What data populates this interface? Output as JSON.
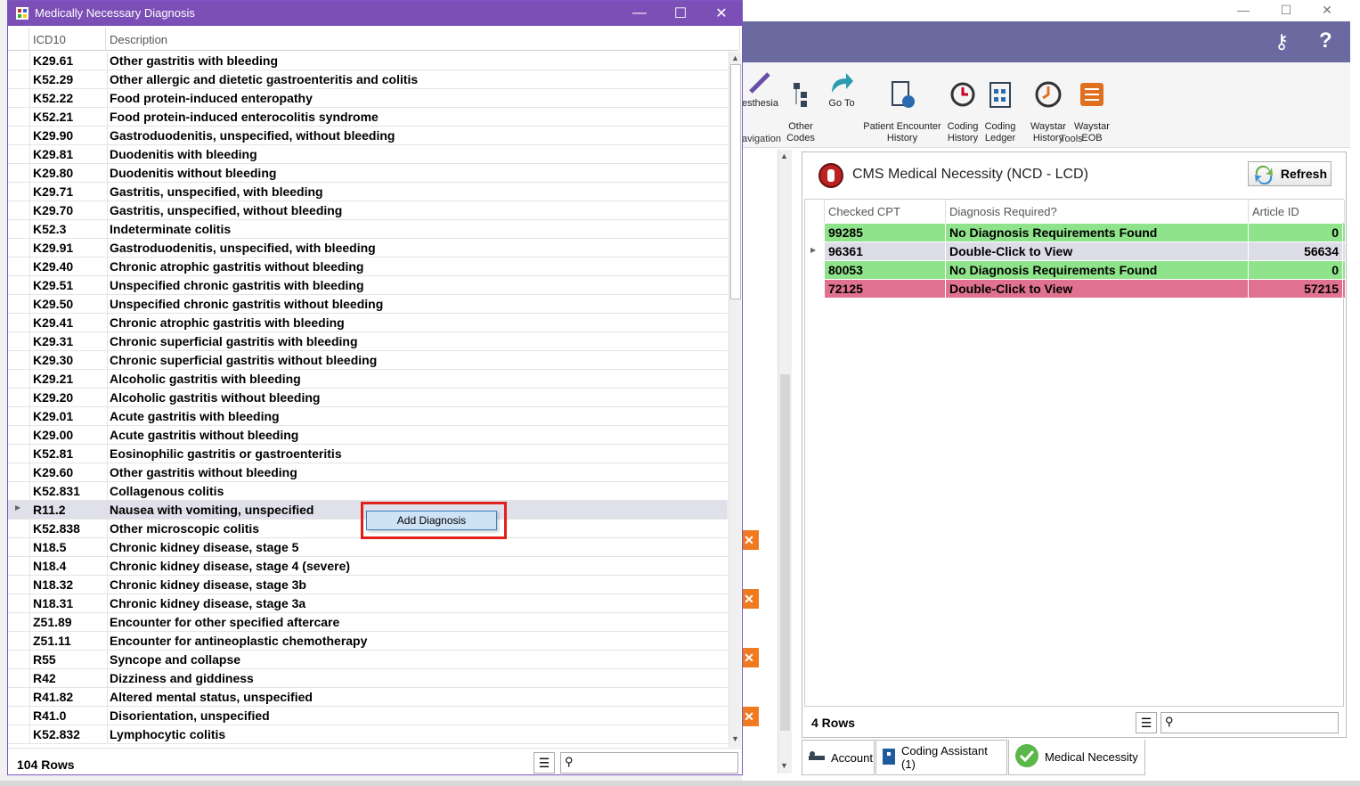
{
  "dialog": {
    "title": "Medically Necessary Diagnosis",
    "columns": [
      "ICD10",
      "Description"
    ],
    "rows": [
      {
        "code": "K29.61",
        "desc": "Other gastritis with bleeding"
      },
      {
        "code": "K52.29",
        "desc": "Other allergic and dietetic gastroenteritis and colitis"
      },
      {
        "code": "K52.22",
        "desc": "Food protein-induced enteropathy"
      },
      {
        "code": "K52.21",
        "desc": "Food protein-induced enterocolitis syndrome"
      },
      {
        "code": "K29.90",
        "desc": "Gastroduodenitis, unspecified, without bleeding"
      },
      {
        "code": "K29.81",
        "desc": "Duodenitis with bleeding"
      },
      {
        "code": "K29.80",
        "desc": "Duodenitis without bleeding"
      },
      {
        "code": "K29.71",
        "desc": "Gastritis, unspecified, with bleeding"
      },
      {
        "code": "K29.70",
        "desc": "Gastritis, unspecified, without bleeding"
      },
      {
        "code": "K52.3",
        "desc": "Indeterminate colitis"
      },
      {
        "code": "K29.91",
        "desc": "Gastroduodenitis, unspecified, with bleeding"
      },
      {
        "code": "K29.40",
        "desc": "Chronic atrophic gastritis without bleeding"
      },
      {
        "code": "K29.51",
        "desc": "Unspecified chronic gastritis with bleeding"
      },
      {
        "code": "K29.50",
        "desc": "Unspecified chronic gastritis without bleeding"
      },
      {
        "code": "K29.41",
        "desc": "Chronic atrophic gastritis with bleeding"
      },
      {
        "code": "K29.31",
        "desc": "Chronic superficial gastritis with bleeding"
      },
      {
        "code": "K29.30",
        "desc": "Chronic superficial gastritis without bleeding"
      },
      {
        "code": "K29.21",
        "desc": "Alcoholic gastritis with bleeding"
      },
      {
        "code": "K29.20",
        "desc": "Alcoholic gastritis without bleeding"
      },
      {
        "code": "K29.01",
        "desc": "Acute gastritis with bleeding"
      },
      {
        "code": "K29.00",
        "desc": "Acute gastritis without bleeding"
      },
      {
        "code": "K52.81",
        "desc": "Eosinophilic gastritis or gastroenteritis"
      },
      {
        "code": "K29.60",
        "desc": "Other gastritis without bleeding"
      },
      {
        "code": "K52.831",
        "desc": "Collagenous colitis"
      },
      {
        "code": "R11.2",
        "desc": "Nausea with vomiting, unspecified",
        "selected": true
      },
      {
        "code": "K52.838",
        "desc": "Other microscopic colitis"
      },
      {
        "code": "N18.5",
        "desc": "Chronic kidney disease, stage 5"
      },
      {
        "code": "N18.4",
        "desc": "Chronic kidney disease, stage 4 (severe)"
      },
      {
        "code": "N18.32",
        "desc": "Chronic kidney disease, stage 3b"
      },
      {
        "code": "N18.31",
        "desc": "Chronic kidney disease, stage 3a"
      },
      {
        "code": "Z51.89",
        "desc": "Encounter for other specified aftercare"
      },
      {
        "code": "Z51.11",
        "desc": "Encounter for antineoplastic chemotherapy"
      },
      {
        "code": "R55",
        "desc": "Syncope and collapse"
      },
      {
        "code": "R42",
        "desc": "Dizziness and giddiness"
      },
      {
        "code": "R41.82",
        "desc": "Altered mental status, unspecified"
      },
      {
        "code": "R41.0",
        "desc": "Disorientation, unspecified"
      },
      {
        "code": "K52.832",
        "desc": "Lymphocytic colitis"
      }
    ],
    "row_count": "104 Rows",
    "context_menu_item": "Add Diagnosis"
  },
  "ribbon": {
    "buttons": [
      {
        "label": "esthesia",
        "icon": "syringe-icon"
      },
      {
        "label": "Other\nCodes",
        "icon": "codes-tree-icon"
      },
      {
        "label": "Go To",
        "icon": "goto-arrow-icon"
      },
      {
        "label": "Patient Encounter\nHistory",
        "icon": "patient-history-icon"
      },
      {
        "label": "Coding\nHistory",
        "icon": "coding-history-icon"
      },
      {
        "label": "Coding\nLedger",
        "icon": "coding-ledger-icon"
      },
      {
        "label": "Waystar\nHistory",
        "icon": "waystar-history-icon"
      },
      {
        "label": "Waystar\nEOB",
        "icon": "waystar-eob-icon"
      }
    ],
    "group_navigation": "avigation",
    "group_tools": "Tools"
  },
  "ncd": {
    "title": "CMS Medical Necessity (NCD - LCD)",
    "refresh_label": "Refresh",
    "columns": [
      "Checked CPT",
      "Diagnosis Required?",
      "Article ID"
    ],
    "rows": [
      {
        "cpt": "99285",
        "diag": "No Diagnosis Requirements Found",
        "article": "0",
        "color": "#8fe38a"
      },
      {
        "cpt": "96361",
        "diag": "Double-Click to View",
        "article": "56634",
        "color": "#dddde8",
        "current": true
      },
      {
        "cpt": "80053",
        "diag": "No Diagnosis Requirements Found",
        "article": "0",
        "color": "#8fe38a"
      },
      {
        "cpt": "72125",
        "diag": "Double-Click to View",
        "article": "57215",
        "color": "#e0728f"
      }
    ],
    "row_count": "4 Rows"
  },
  "tabs": [
    {
      "label": "Account",
      "icon": "bed-icon"
    },
    {
      "label": "Coding Assistant (1)",
      "icon": "book-icon"
    },
    {
      "label": "Medical Necessity",
      "icon": "checkmark-icon"
    }
  ]
}
